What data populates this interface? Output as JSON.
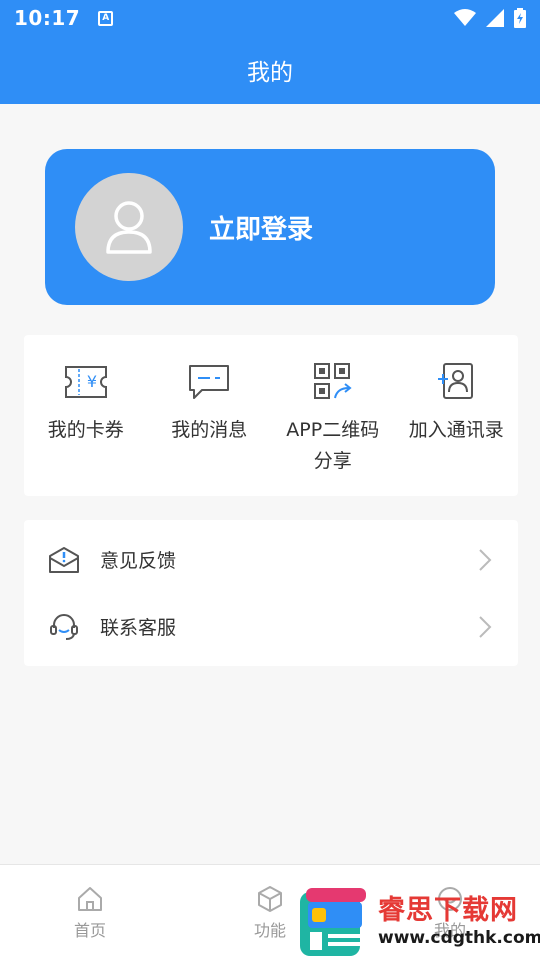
{
  "status_bar": {
    "time": "10:17",
    "notif_glyph": "A"
  },
  "title": "我的",
  "login": {
    "label": "立即登录"
  },
  "quick_actions": [
    {
      "label": "我的卡券",
      "icon": "coupon-icon"
    },
    {
      "label": "我的消息",
      "icon": "message-icon"
    },
    {
      "label": "APP二维码分享",
      "icon": "qr-share-icon"
    },
    {
      "label": "加入通讯录",
      "icon": "add-contact-icon"
    }
  ],
  "list": [
    {
      "label": "意见反馈",
      "icon": "feedback-mail-icon"
    },
    {
      "label": "联系客服",
      "icon": "headset-icon"
    }
  ],
  "tabs": [
    {
      "label": "首页",
      "icon": "home-icon"
    },
    {
      "label": "功能",
      "icon": "cube-icon"
    },
    {
      "label": "我的",
      "icon": "profile-icon"
    }
  ],
  "watermark": {
    "cn": "睿思下载网",
    "url": "www.cdgthk.com"
  },
  "colors": {
    "primary": "#2f8ef6",
    "background": "#f7f7f7",
    "watermark_red": "#e53935"
  }
}
